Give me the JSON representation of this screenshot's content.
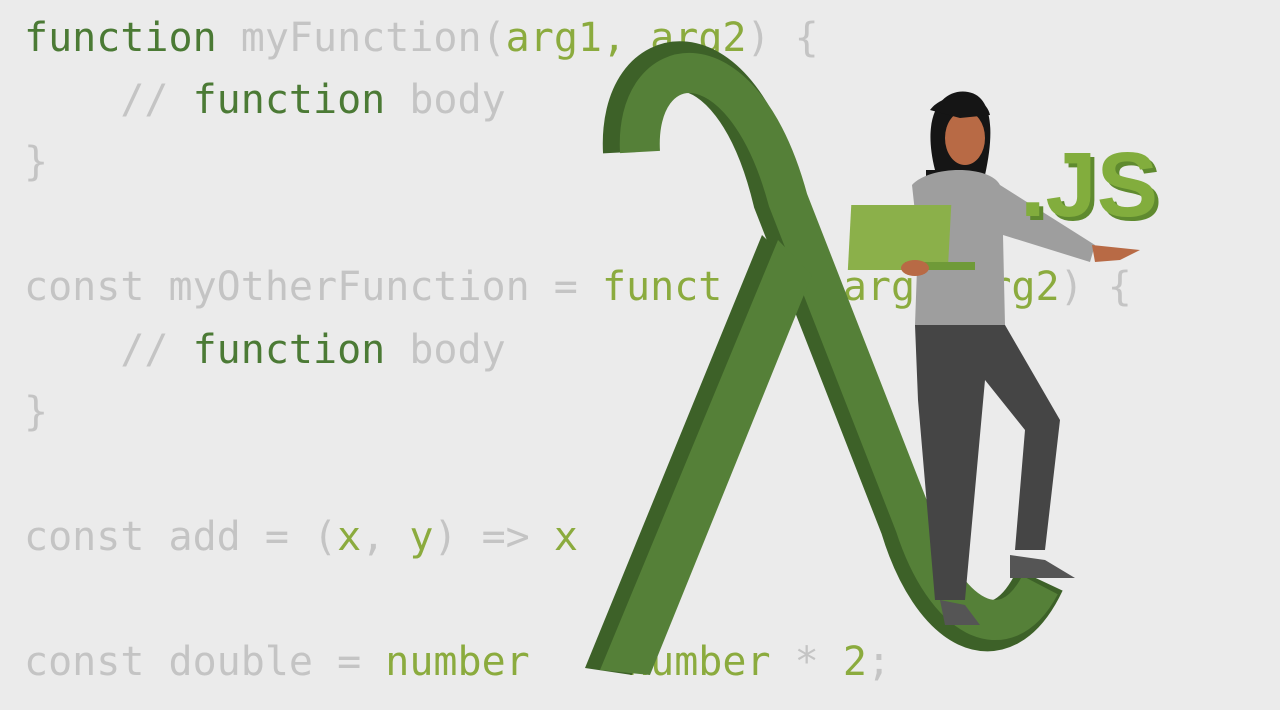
{
  "code_lines": [
    {
      "tokens": [
        {
          "t": "function ",
          "c": "dg"
        },
        {
          "t": "myFunction(",
          "c": "g"
        },
        {
          "t": "arg1, arg2",
          "c": "lg"
        },
        {
          "t": ") {",
          "c": "g"
        }
      ]
    },
    {
      "tokens": [
        {
          "t": "    // ",
          "c": "g"
        },
        {
          "t": "function ",
          "c": "dg"
        },
        {
          "t": "body",
          "c": "g"
        }
      ]
    },
    {
      "tokens": [
        {
          "t": "}",
          "c": "g"
        }
      ]
    },
    {
      "tokens": [
        {
          "t": "const myOtherFunction = ",
          "c": "g"
        },
        {
          "t": "funct",
          "c": "lg"
        },
        {
          "t": "     ",
          "c": "g"
        },
        {
          "t": "arg",
          "c": "lg"
        },
        {
          "t": "  ",
          "c": "g"
        },
        {
          "t": "arg2",
          "c": "lg"
        },
        {
          "t": ") {",
          "c": "g"
        }
      ]
    },
    {
      "tokens": [
        {
          "t": "    // ",
          "c": "g"
        },
        {
          "t": "function ",
          "c": "dg"
        },
        {
          "t": "body",
          "c": "g"
        }
      ]
    },
    {
      "tokens": [
        {
          "t": "}",
          "c": "g"
        }
      ]
    },
    {
      "tokens": [
        {
          "t": "const add = (",
          "c": "g"
        },
        {
          "t": "x",
          "c": "lg"
        },
        {
          "t": ", ",
          "c": "g"
        },
        {
          "t": "y",
          "c": "lg"
        },
        {
          "t": ") => ",
          "c": "g"
        },
        {
          "t": "x",
          "c": "lg"
        }
      ]
    },
    {
      "tokens": [
        {
          "t": "const double = ",
          "c": "g"
        },
        {
          "t": "number",
          "c": "lg"
        },
        {
          "t": "    ",
          "c": "g"
        },
        {
          "t": "number",
          "c": "lg"
        },
        {
          "t": " * ",
          "c": "g"
        },
        {
          "t": "2",
          "c": "lg"
        },
        {
          "t": ";",
          "c": "g"
        }
      ]
    }
  ],
  "logo_text": ".JS",
  "colors": {
    "background": "#ebebeb",
    "lambda": "#558038",
    "lambda_dark": "#3d6128",
    "logo": "#82ad3d"
  }
}
